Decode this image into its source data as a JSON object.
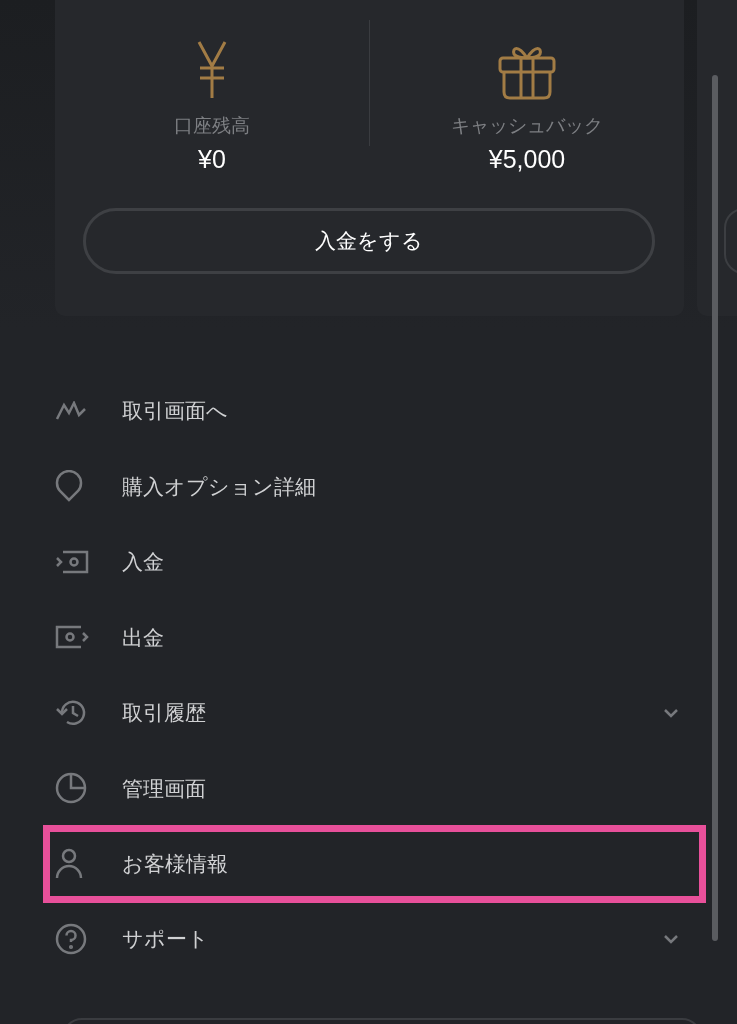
{
  "wallet_card": {
    "balances": [
      {
        "kind": "yen",
        "label": "口座残高",
        "value": "¥0"
      },
      {
        "kind": "gift",
        "label": "キャッシュバック",
        "value": "¥5,000"
      }
    ],
    "deposit_button": "入金をする"
  },
  "menu": [
    {
      "label": "取引画面へ",
      "expandable": false,
      "highlighted": false
    },
    {
      "label": "購入オプション詳細",
      "expandable": false,
      "highlighted": false
    },
    {
      "label": "入金",
      "expandable": false,
      "highlighted": false
    },
    {
      "label": "出金",
      "expandable": false,
      "highlighted": false
    },
    {
      "label": "取引履歴",
      "expandable": true,
      "highlighted": false
    },
    {
      "label": "管理画面",
      "expandable": false,
      "highlighted": false
    },
    {
      "label": "お客様情報",
      "expandable": false,
      "highlighted": true
    },
    {
      "label": "サポート",
      "expandable": true,
      "highlighted": false
    }
  ]
}
